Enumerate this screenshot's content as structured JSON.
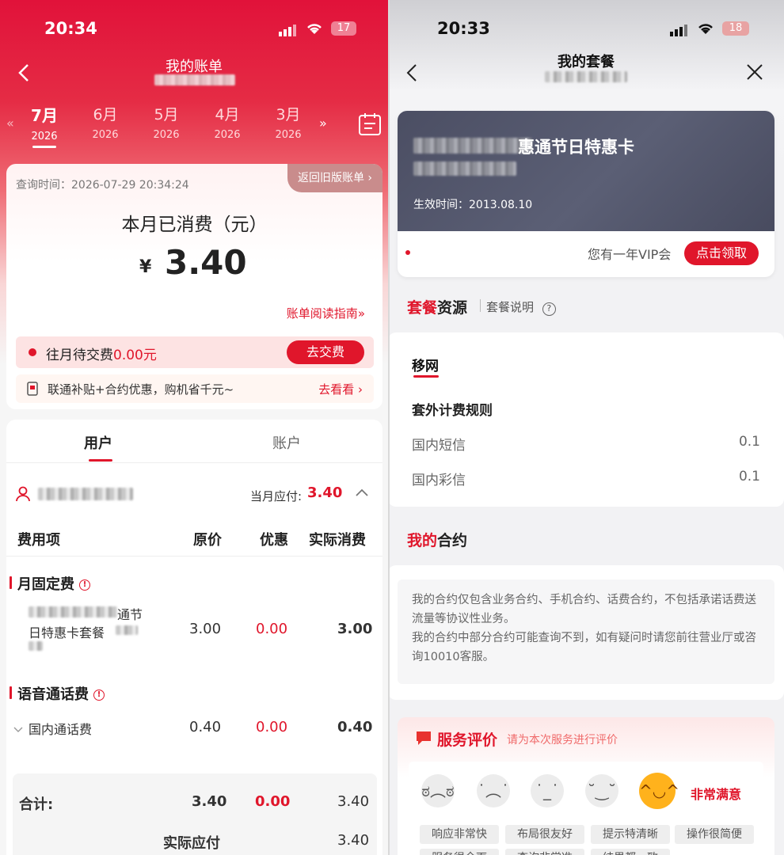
{
  "left": {
    "status": {
      "time": "20:34",
      "battery": "17"
    },
    "title": "我的账单",
    "months": [
      {
        "month": "7月",
        "year": "2026"
      },
      {
        "month": "6月",
        "year": "2026"
      },
      {
        "month": "5月",
        "year": "2026"
      },
      {
        "month": "4月",
        "year": "2026"
      },
      {
        "month": "3月",
        "year": "2026"
      }
    ],
    "query_time": "查询时间：2026-07-29 20:34:24",
    "old_bill": "返回旧版账单",
    "consumed_label": "本月已消费（元）",
    "currency": "¥",
    "amount": "3.40",
    "guide_link": "账单阅读指南",
    "pending_label": "往月待交费",
    "pending_amount": "0.00元",
    "pay_button": "去交费",
    "promo_text": "联通补贴+合约优惠，购机省千元~",
    "promo_link": "去看看",
    "tabs": [
      "用户",
      "账户"
    ],
    "due_label": "当月应付:",
    "due_amount": "3.40",
    "columns": [
      "费用项",
      "原价",
      "优惠",
      "实际消费"
    ],
    "sections": [
      {
        "title": "月固定费",
        "row_name_line1": "通节",
        "row_name_line2": "日特惠卡套餐",
        "price": "3.00",
        "discount": "0.00",
        "actual": "3.00"
      },
      {
        "title": "语音通话费",
        "row_name_line1": "国内通话费",
        "price": "0.40",
        "discount": "0.00",
        "actual": "0.40"
      }
    ],
    "total_label": "合计:",
    "total_price": "3.40",
    "total_discount": "0.00",
    "total_actual": "3.40",
    "payable_label": "实际应付",
    "payable_amount": "3.40",
    "accent": "#e0162b"
  },
  "right": {
    "status": {
      "time": "20:33",
      "battery": "18"
    },
    "title": "我的套餐",
    "package_name": "惠通节日特惠卡",
    "effective_date": "生效时间：2013.08.10",
    "vip_text": "您有一年VIP会",
    "vip_button": "点击领取",
    "resources_title_a": "套餐",
    "resources_title_b": "资源",
    "resources_help": "套餐说明",
    "tab_label": "移网",
    "extra_rules": "套外计费规则",
    "rules": [
      {
        "name": "国内短信",
        "value": "0.1"
      },
      {
        "name": "国内彩信",
        "value": "0.1"
      }
    ],
    "contract_title_a": "我的",
    "contract_title_b": "合约",
    "contract_note_1": "我的合约仅包含业务合约、手机合约、话费合约，不包括承诺话费送流量等协议性业务。",
    "contract_note_2": "我的合约中部分合约可能查询不到，如有疑问时请您前往营业厅或咨询10010客服。",
    "rating_title": "服务评价",
    "rating_subtitle": "请为本次服务进行评价",
    "rating_selected": "非常满意",
    "tags": [
      "响应非常快",
      "布局很友好",
      "提示特清晰",
      "操作很简便",
      "服务很全面",
      "查询非常准",
      "结果都一致"
    ]
  }
}
